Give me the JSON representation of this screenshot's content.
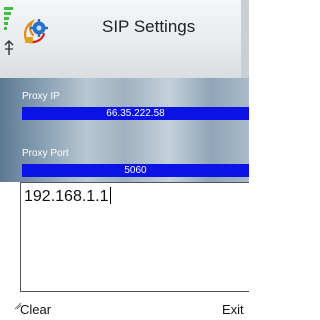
{
  "header": {
    "title": "SIP Settings",
    "signal_icon": "signal-strength-icon",
    "app_icon": "settings-gear-icon"
  },
  "fields": [
    {
      "label": "Proxy IP",
      "value": "66.35.222.58"
    },
    {
      "label": "Proxy Port",
      "value": "5060"
    }
  ],
  "editor": {
    "value": "192.168.1.1"
  },
  "softkeys": {
    "left": "Clear",
    "right": "Exit"
  },
  "colors": {
    "field_highlight": "#0b12e6",
    "signal_green": "#3cc23c"
  }
}
